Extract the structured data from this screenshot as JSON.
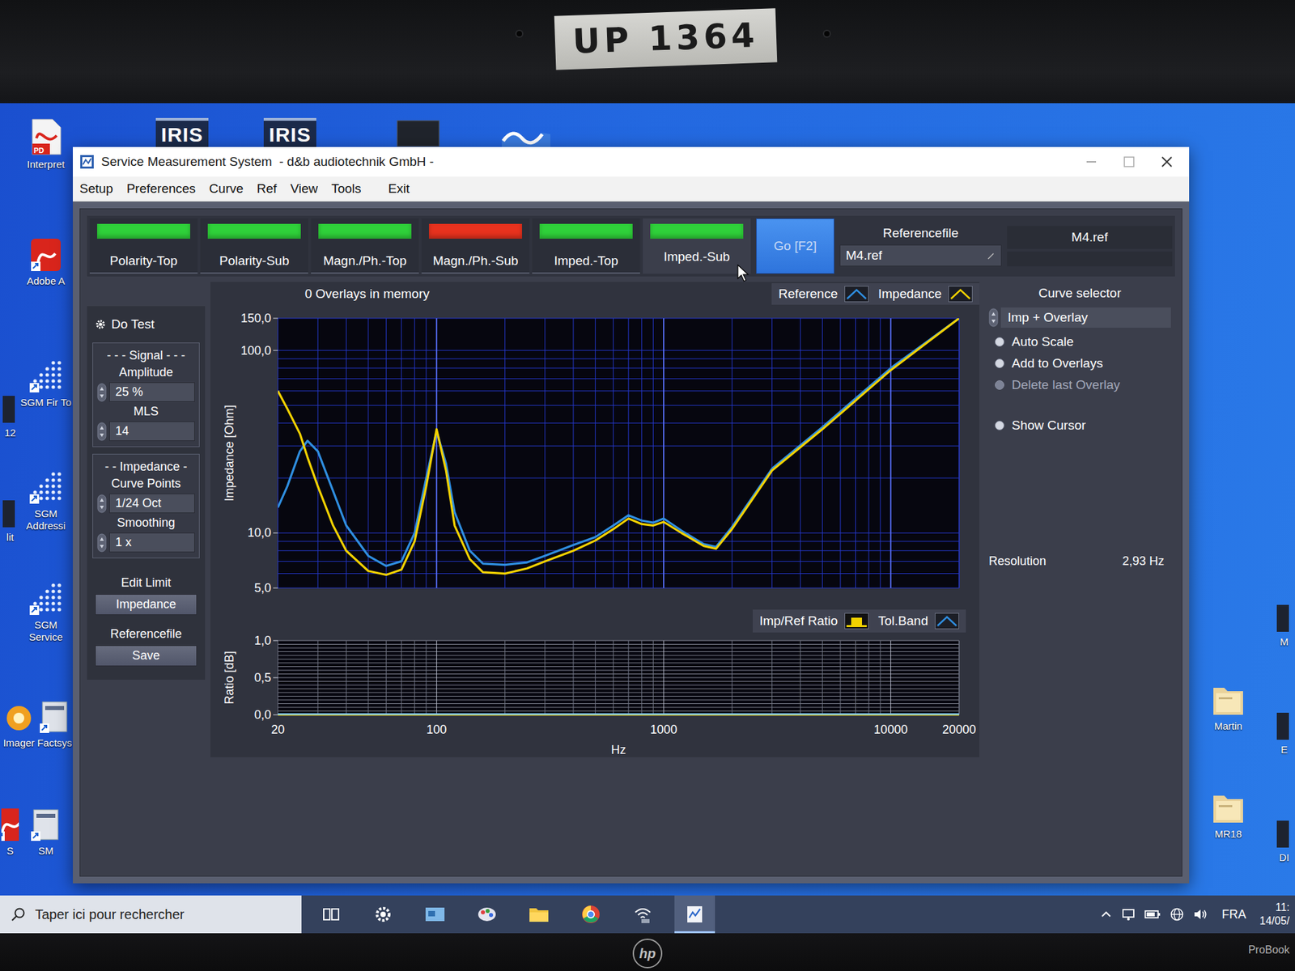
{
  "bezel": {
    "tape_label": "UP 1364",
    "brand": "hp",
    "model": "ProBook"
  },
  "desktop_icons": [
    {
      "label": "Interpret",
      "kind": "pdf",
      "badge": "PD"
    },
    {
      "label": "Adobe A",
      "kind": "adobe"
    },
    {
      "label": "SGM Fir To",
      "kind": "sgm"
    },
    {
      "label": "SGM Addressi",
      "kind": "sgm"
    },
    {
      "label": "SGM Service",
      "kind": "sgm"
    },
    {
      "label": "Imager",
      "kind": "imager"
    },
    {
      "label": "Factsys",
      "kind": "app"
    },
    {
      "label": "SM",
      "kind": "app"
    },
    {
      "label": "12",
      "kind": "partial"
    },
    {
      "label": "lit",
      "kind": "partial"
    },
    {
      "label": "S",
      "kind": "adobe"
    },
    {
      "label": "Martin",
      "kind": "folder"
    },
    {
      "label": "MR18",
      "kind": "folder"
    },
    {
      "label": "M",
      "kind": "partial"
    },
    {
      "label": "E",
      "kind": "partial"
    },
    {
      "label": "DI",
      "kind": "partial"
    }
  ],
  "top_icons": [
    {
      "kind": "iris",
      "logo": "IRIS"
    },
    {
      "kind": "iris",
      "logo": "IRIS"
    },
    {
      "kind": "monitor"
    },
    {
      "kind": "wave"
    }
  ],
  "window": {
    "title": "Service Measurement System  - d&b audiotechnik GmbH -"
  },
  "menu": [
    "Setup",
    "Preferences",
    "Curve",
    "Ref",
    "View",
    "Tools",
    "Exit"
  ],
  "tabs": [
    {
      "label": "Polarity-Top",
      "color": "#2fd13a",
      "selected": false
    },
    {
      "label": "Polarity-Sub",
      "color": "#2fd13a",
      "selected": false
    },
    {
      "label": "Magn./Ph.-Top",
      "color": "#2fd13a",
      "selected": false
    },
    {
      "label": "Magn./Ph.-Sub",
      "color": "#e8321e",
      "selected": false
    },
    {
      "label": "Imped.-Top",
      "color": "#2fd13a",
      "selected": false
    },
    {
      "label": "Imped.-Sub",
      "color": "#2fd13a",
      "selected": true
    }
  ],
  "go_button": "Go [F2]",
  "referencefile": {
    "label": "Referencefile",
    "value": "M4.ref",
    "display": "M4.ref"
  },
  "left_panel": {
    "do_test": "Do Test",
    "signal": {
      "heading": "- - - Signal - - -",
      "fields": [
        {
          "label": "Amplitude",
          "value": "25 %"
        },
        {
          "label": "MLS",
          "value": "14"
        }
      ]
    },
    "impedance": {
      "heading": "- - Impedance -",
      "fields": [
        {
          "label": "Curve Points",
          "value": "1/24 Oct"
        },
        {
          "label": "Smoothing",
          "value": "1 x"
        }
      ]
    },
    "edit_limit": {
      "label": "Edit Limit",
      "button": "Impedance"
    },
    "reference": {
      "label": "Referencefile",
      "button": "Save"
    }
  },
  "chart": {
    "overlays_text": "0 Overlays in memory",
    "y_label": "Impedance [Ohm]",
    "y_ticks": [
      {
        "label": "150,0",
        "value": 150
      },
      {
        "label": "100,0",
        "value": 100
      },
      {
        "label": "10,0",
        "value": 10
      },
      {
        "label": "5,0",
        "value": 5
      }
    ],
    "frequencies": [
      20,
      22,
      25,
      27,
      30,
      35,
      40,
      50,
      60,
      70,
      80,
      90,
      100,
      110,
      120,
      140,
      160,
      200,
      250,
      300,
      400,
      500,
      600,
      700,
      800,
      900,
      1000,
      1200,
      1500,
      1700,
      2000,
      3000,
      5000,
      10000,
      20000
    ],
    "series": [
      {
        "label": "Reference",
        "color": "#2f8ee0",
        "values": [
          13.8,
          18,
          28,
          32,
          28,
          17,
          11,
          7.5,
          6.6,
          7,
          10,
          20,
          36,
          24,
          13,
          8,
          6.8,
          6.7,
          6.9,
          7.5,
          8.6,
          9.5,
          11,
          12.5,
          11.7,
          11.4,
          12,
          10.3,
          8.7,
          8.4,
          10.8,
          22.5,
          38,
          80,
          150
        ]
      },
      {
        "label": "Impedance",
        "color": "#f2d200",
        "values": [
          60,
          48,
          35,
          26,
          18,
          11,
          8,
          6.2,
          5.9,
          6.3,
          9,
          18,
          37,
          22,
          11,
          7.2,
          6.1,
          6.0,
          6.4,
          7.0,
          8.0,
          9.1,
          10.5,
          12,
          11.2,
          11,
          11.5,
          10,
          8.5,
          8.2,
          10.5,
          22,
          37,
          78,
          150
        ]
      }
    ]
  },
  "ratio_chart": {
    "y_label": "Ratio [dB]",
    "y_ticks": [
      {
        "label": "1,0",
        "value": 1
      },
      {
        "label": "0,5",
        "value": 0.5
      },
      {
        "label": "0,0",
        "value": 0
      }
    ],
    "x_ticks": [
      {
        "label": "20",
        "value": 20
      },
      {
        "label": "100",
        "value": 100
      },
      {
        "label": "1000",
        "value": 1000
      },
      {
        "label": "10000",
        "value": 10000
      },
      {
        "label": "20000",
        "value": 20000
      }
    ],
    "x_label": "Hz",
    "series": [
      {
        "label": "Imp/Ref Ratio",
        "color": "#f2d200",
        "values": [
          0,
          0,
          0,
          0,
          0,
          0,
          0,
          0,
          0,
          0,
          0,
          0,
          0,
          0,
          0,
          0,
          0,
          0,
          0,
          0,
          0,
          0,
          0,
          0,
          0,
          0,
          0,
          0,
          0,
          0,
          0,
          0,
          0,
          0,
          0
        ]
      },
      {
        "label": "Tol.Band",
        "color": "#7fc8ff",
        "values": [
          0.01,
          0.01,
          0.01,
          0.01,
          0.01,
          0.01,
          0.01,
          0.01,
          0.01,
          0.01,
          0.01,
          0.01,
          0.01,
          0.01,
          0.01,
          0.01,
          0.01,
          0.01,
          0.01,
          0.01,
          0.01,
          0.01,
          0.01,
          0.01,
          0.01,
          0.01,
          0.01,
          0.01,
          0.01,
          0.01,
          0.01,
          0.01,
          0.01,
          0.01,
          0.01
        ]
      }
    ]
  },
  "right_panel": {
    "curve_selector": {
      "label": "Curve selector",
      "value": "Imp + Overlay"
    },
    "options": [
      {
        "label": "Auto Scale",
        "disabled": false
      },
      {
        "label": "Add to Overlays",
        "disabled": false
      },
      {
        "label": "Delete last Overlay",
        "disabled": true
      },
      {
        "label": "Show Cursor",
        "disabled": false
      }
    ],
    "resolution": {
      "label": "Resolution",
      "value": "2,93 Hz"
    }
  },
  "taskbar": {
    "search_placeholder": "Taper ici pour rechercher",
    "apps": [
      {
        "kind": "taskview",
        "active": false
      },
      {
        "kind": "gear",
        "active": false
      },
      {
        "kind": "card",
        "active": false
      },
      {
        "kind": "paint",
        "active": false
      },
      {
        "kind": "folder",
        "active": false
      },
      {
        "kind": "chrome",
        "active": false
      },
      {
        "kind": "network",
        "active": false
      },
      {
        "kind": "measure",
        "active": true
      }
    ],
    "tray": {
      "language": "FRA",
      "time": "11:",
      "date": "14/05/"
    }
  }
}
